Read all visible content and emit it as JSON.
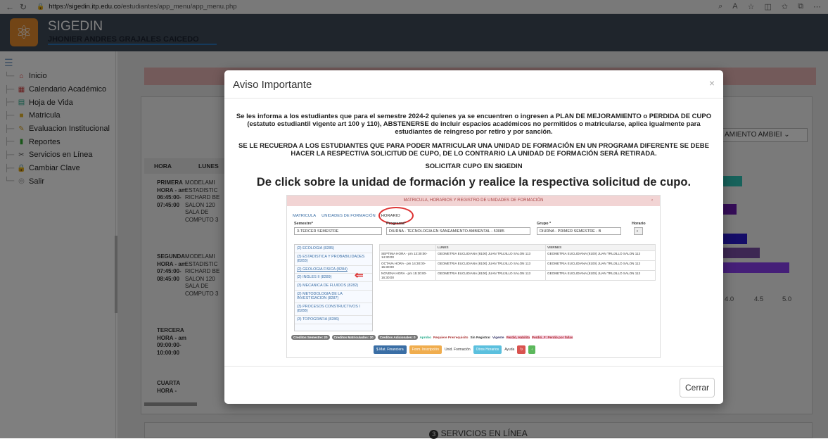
{
  "browser": {
    "url_host": "https://sigedin.itp.edu.co",
    "url_path": "/estudiantes/app_menu/app_menu.php"
  },
  "header": {
    "app_name": "SIGEDIN",
    "user_name": "JHONIER ANDRES GRAJALES CAICEDO"
  },
  "sidebar": {
    "items": [
      {
        "label": "Inicio",
        "icon": "home-icon"
      },
      {
        "label": "Calendario Académico",
        "icon": "calendar-icon"
      },
      {
        "label": "Hoja de Vida",
        "icon": "resume-icon"
      },
      {
        "label": "Matricula",
        "icon": "folder-icon"
      },
      {
        "label": "Evaluacion Institucional",
        "icon": "pencil-icon"
      },
      {
        "label": "Reportes",
        "icon": "bar-chart-icon"
      },
      {
        "label": "Servicios en Línea",
        "icon": "tools-icon"
      },
      {
        "label": "Cambiar Clave",
        "icon": "lock-icon"
      },
      {
        "label": "Salir",
        "icon": "exit-icon"
      }
    ]
  },
  "background": {
    "program_select": "AMIENTO AMBIEI",
    "schedule_headers": [
      "HORA",
      "LUNES"
    ],
    "rows": [
      {
        "hora": "PRIMERA HORA - am 06:45:00- 07:45:00",
        "detalle": "MODELAMI ESTADISTIC RICHARD BE SALON 120 SALA DE COMPUTO 3"
      },
      {
        "hora": "SEGUNDA HORA - am 07:45:00- 08:45:00",
        "detalle": "MODELAMI ESTADISTIC RICHARD BE SALON 120 SALA DE COMPUTO 3"
      },
      {
        "hora": "TERCERA HORA - am 09:00:00- 10:00:00",
        "detalle": ""
      },
      {
        "hora": "CUARTA HORA -",
        "detalle": ""
      }
    ],
    "axis_ticks": [
      "4.0",
      "4.5",
      "5.0"
    ],
    "services_title": "SERVICIOS EN LÍNEA",
    "services_number": "3"
  },
  "modal": {
    "title": "Aviso Importante",
    "close_symbol": "×",
    "paragraph1": "Se les informa a los estudiantes que para el semestre 2024-2 quienes ya se encuentren o ingresen a PLAN DE MEJORAMIENTO o PERDIDA DE CUPO (estatuto estudiantil vigente art 100 y 110), ABSTENERSE de incluir espacios académicos no permitidos o matricularse, aplica igualmente para estudiantes de reingreso por retiro y por sanción.",
    "paragraph2": "SE LE RECUERDA A LOS ESTUDIANTES QUE PARA PODER MATRICULAR UNA UNIDAD DE FORMACIÓN EN UN PROGRAMA DIFERENTE SE DEBE HACER LA RESPECTIVA SOLICITUD DE CUPO, DE LO CONTRARIO LA UNIDAD DE FORMACIÓN SERÁ RETIRADA.",
    "paragraph3": "SOLICITAR CUPO EN SIGEDIN",
    "paragraph4": "De click sobre la unidad de formación y realice la respectiva solicitud de cupo.",
    "close_button": "Cerrar"
  },
  "example": {
    "header": "MATRICULA, HORARIOS Y REGISTRO DE UNIDADES DE FORMACIÓN",
    "tabs": [
      "MATRICULA",
      "UNIDADES DE FORMACIÓN",
      "HORARIO"
    ],
    "semestre_label": "Semestre*",
    "semestre_value": "3-TERCER SEMESTRE",
    "programa_label": "Programa*",
    "programa_value": "DIURNA - TECNOLOGIA EN SANEAMIENTO AMBIENTAL - 53085",
    "grupo_label": "Grupo *",
    "grupo_value": "DIURNA - PRIMER SEMESTRE - B",
    "horario_label": "Horario",
    "units": [
      "(2) ECOLOGIA (8285)",
      "(3) ESTADISTICA Y PROBABILIDADES (8283)",
      "(2) GEOLOGIA FISICA (8284)",
      "(2) INGLES II (8289)",
      "(3) MECANICA DE FLUIDOS (8282)",
      "(2) METODOLOGIA DE LA INVESTIGACION (8287)",
      "(3) PROCESOS CONSTRUCTIVOS I (8288)",
      "(3) TOPOGRAFIA (8286)"
    ],
    "table_headers": [
      "",
      "LUNES",
      "VIERNES"
    ],
    "table_rows": [
      [
        "SEPTIMA HORA - pm 13:30:00-14:30:00",
        "GEOMETRIA EUCLIDIANA (8100) JUAN TRUJILLO SALON 113",
        "GEOMETRIA EUCLIDIANA (8100) JUAN TRUJILLO SALON 113"
      ],
      [
        "OCTAVA HORA - pm 14:30:00-15:30:00",
        "GEOMETRIA EUCLIDIANA (8100) JUAN TRUJILLO SALON 113",
        "GEOMETRIA EUCLIDIANA (8100) JUAN TRUJILLO SALON 113"
      ],
      [
        "NOVENA HORA - pm 15:30:00-16:30:00",
        "GEOMETRIA EUCLIDIANA (8100) JUAN TRUJILLO SALON 113",
        "GEOMETRIA EUCLIDIANA (8100) JUAN TRUJILLO SALON 113"
      ]
    ],
    "badges": [
      "Creditos Semestre: 20",
      "Creditos Matriculados: 20",
      "Creditos Adicionales: 0"
    ],
    "legend": [
      "Aprobo",
      "Requiere Prerrequisito",
      "Sin Registrar",
      "Vigente",
      "Perdió, Habilita",
      "Perdió_F: Perdió por fallas"
    ],
    "buttons": [
      "$ Mat. Financiera",
      "Form. Inscripción",
      "Unid. Formación",
      "Otros Horarios",
      "Ayuda"
    ]
  }
}
